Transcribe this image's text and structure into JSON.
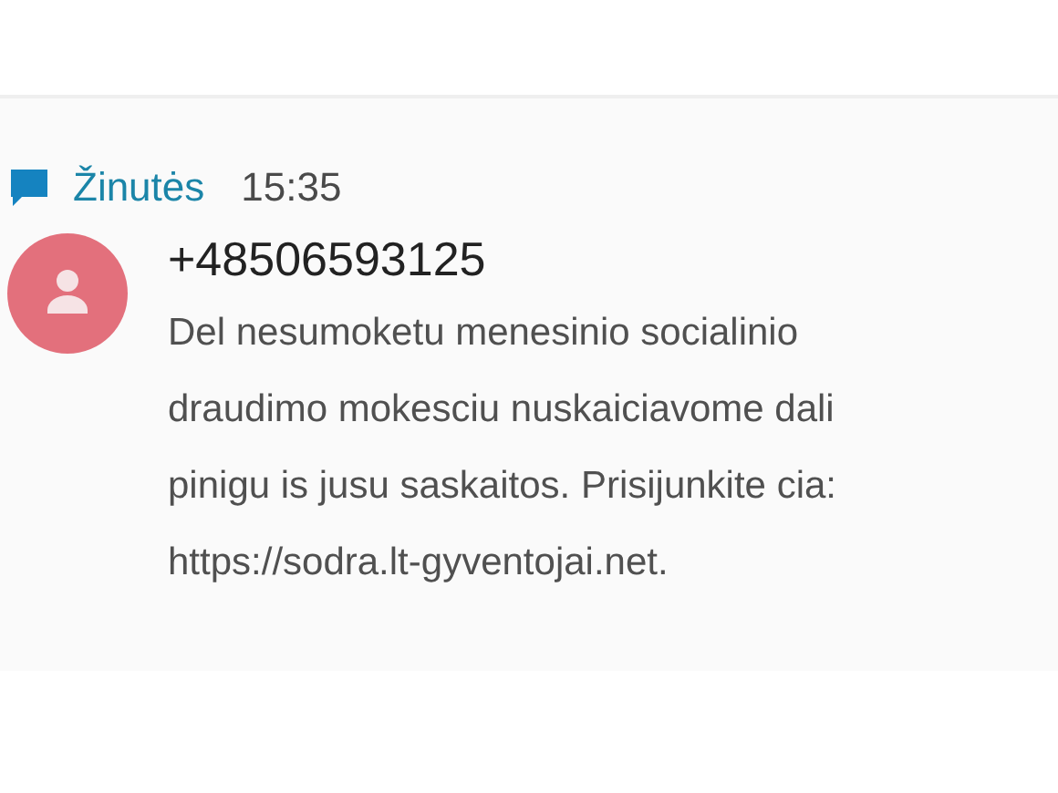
{
  "notification": {
    "app_name": "Žinutės",
    "time": "15:35",
    "sender": "+48506593125",
    "message_lines": [
      "Del nesumoketu menesinio socialinio",
      "draudimo mokesciu nuskaiciavome dali",
      "pinigu is jusu saskaitos. Prisijunkite cia:",
      "https://sodra.lt-gyventojai.net."
    ]
  }
}
